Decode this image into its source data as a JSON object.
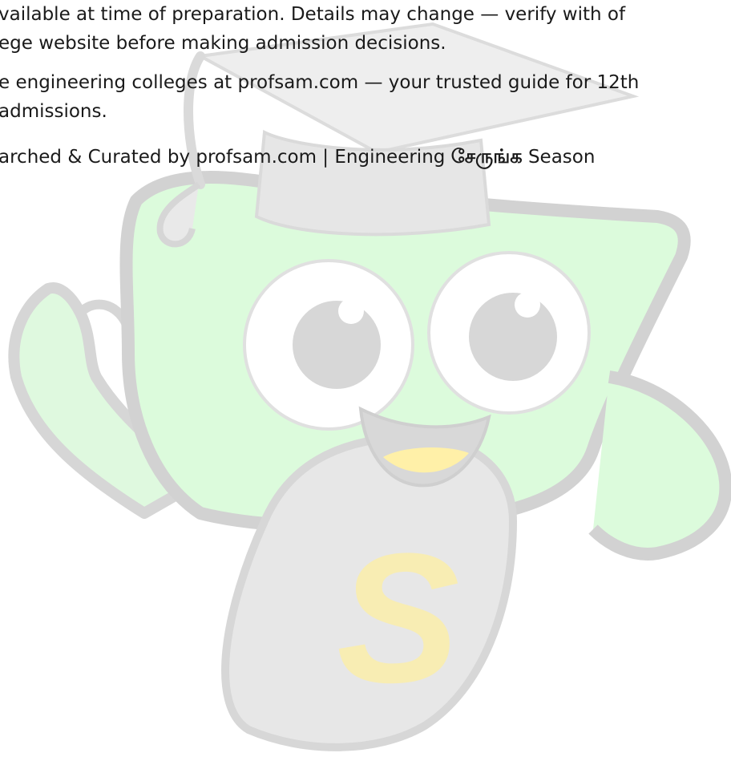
{
  "document": {
    "line1": "vailable at time of preparation. Details may change — verify with of",
    "line2": "ege website before making admission decisions.",
    "line3": "e engineering colleges at profsam.com — your trusted guide for 12th",
    "line4": "admissions.",
    "line5_prefix": "arched & Curated by profsam.com | Engineering ",
    "line5_tamil": "சேருங்க",
    "line5_suffix": " Season"
  },
  "watermark": {
    "logo_letter": "S",
    "colors": {
      "body_green": "#dcfbdc",
      "outline_gray": "#d2d2d2",
      "cap_gray": "#e7e7e7",
      "mouth_yellow": "#fff0a8",
      "letter_yellow": "#ffef9c"
    }
  }
}
